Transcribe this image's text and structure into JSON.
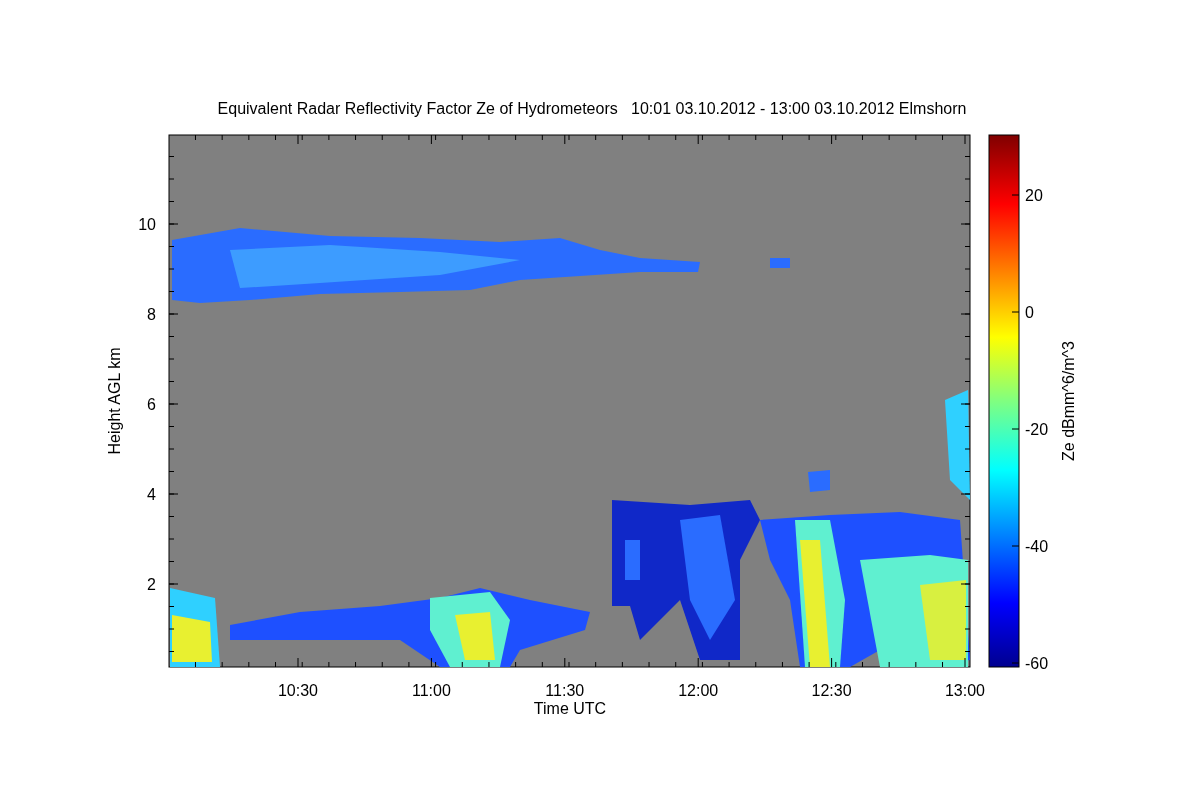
{
  "figure": {
    "title": "Equivalent Radar Reflectivity Factor Ze of Hydrometeors   10:01 03.10.2012 - 13:00 03.10.2012 Elmshorn",
    "ylabel": "Height AGL km",
    "xlabel": "Time UTC",
    "yticks": [
      "10",
      "8",
      "6",
      "4",
      "2"
    ],
    "xticks": [
      "10:30",
      "11:00",
      "11:30",
      "12:00",
      "12:30",
      "13:00"
    ]
  },
  "colorbar": {
    "label": "Ze dBmm^6/m^3",
    "ticks": [
      "20",
      "0",
      "-20",
      "-40",
      "-60"
    ]
  }
}
